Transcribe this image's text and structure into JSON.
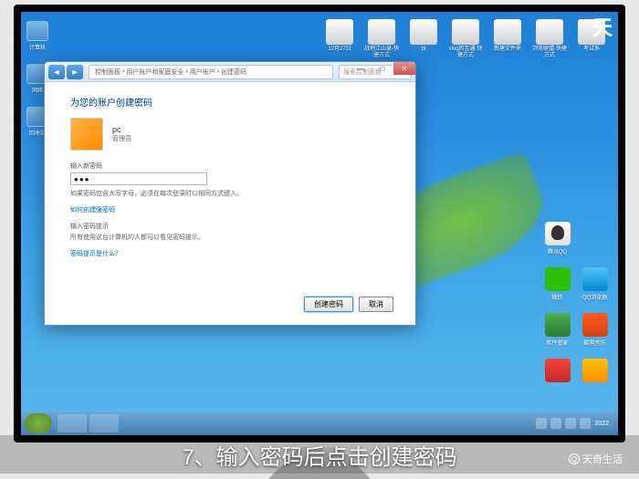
{
  "topCorner": "天",
  "desktop": {
    "leftIcons": [
      {
        "label": "计算机"
      },
      {
        "label": "网络"
      },
      {
        "label": "回收站"
      }
    ],
    "topIcons": [
      {
        "label": "12月27日"
      },
      {
        "label": "战地江山录-快捷方式"
      },
      {
        "label": "pt"
      },
      {
        "label": "vlog的互通 快捷方式"
      },
      {
        "label": "新建文件夹"
      },
      {
        "label": "浏览联盟-快捷方式"
      },
      {
        "label": "考试系"
      }
    ],
    "rightIcons": [
      [
        {
          "label": "腾讯QQ",
          "cls": "qq"
        }
      ],
      [
        {
          "label": "微信",
          "cls": "wechat"
        },
        {
          "label": "QQ浏览器",
          "cls": "browser"
        }
      ],
      [
        {
          "label": "软件管家",
          "cls": "sec"
        },
        {
          "label": "酷狗音乐",
          "cls": "music"
        }
      ],
      [
        {
          "label": "",
          "cls": "red"
        },
        {
          "label": "",
          "cls": "k"
        }
      ]
    ]
  },
  "window": {
    "breadcrumb": {
      "p1": "控制面板",
      "p2": "用户账户和家庭安全",
      "p3": "用户账户",
      "p4": "创建密码"
    },
    "searchPlaceholder": "搜索控制面板",
    "heading": "为您的账户创建密码",
    "user": {
      "name": "pc",
      "role": "管理员"
    },
    "pwdLabel": "输入新密码",
    "pwdValue": "●●●",
    "pwdHint": "如果密码包含大写字母，必须在每次登录时以相同方式键入。",
    "linkHelp": "如何创建强密码",
    "hintLabel": "输入密码提示",
    "hintText": "所有使用这台计算机的人都可以看见密码提示。",
    "linkHint": "密码提示是什么？",
    "btnCreate": "创建密码",
    "btnCancel": "取消"
  },
  "taskbar": {
    "time": "2022"
  },
  "caption": "7、输入密码后点击创建密码",
  "watermark": "天奇生活"
}
